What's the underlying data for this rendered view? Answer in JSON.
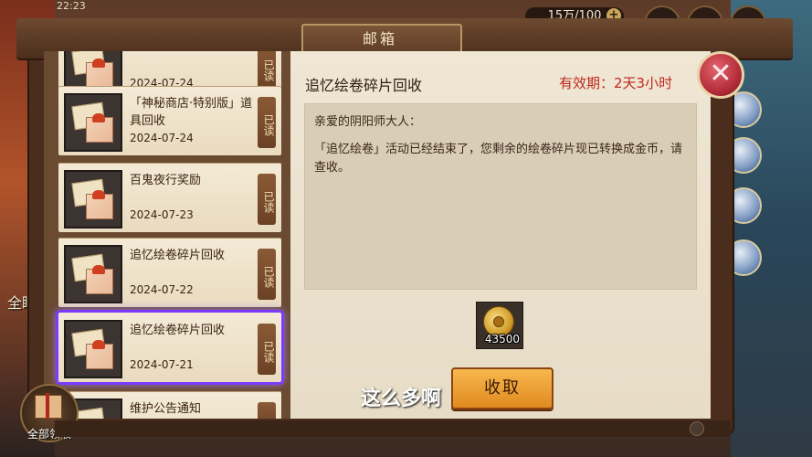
{
  "hud": {
    "time": "22:23",
    "currency": "15万/100",
    "plus": "+"
  },
  "window": {
    "title": "邮箱",
    "close_glyph": "✕"
  },
  "mail_list": [
    {
      "title": "",
      "date": "2024-07-24",
      "read": "已读"
    },
    {
      "title": "「神秘商店·特别版」道具回收",
      "date": "2024-07-24",
      "read": "已读"
    },
    {
      "title": "百鬼夜行奖励",
      "date": "2024-07-23",
      "read": "已读"
    },
    {
      "title": "追忆绘卷碎片回收",
      "date": "2024-07-22",
      "read": "已读"
    },
    {
      "title": "追忆绘卷碎片回收",
      "date": "2024-07-21",
      "read": "已读"
    },
    {
      "title": "维护公告通知",
      "date": "",
      "read": ""
    }
  ],
  "detail": {
    "title": "追忆绘卷碎片回收",
    "expiry": "有效期：2天3小时",
    "greeting": "亲爱的阴阳师大人：",
    "body": "「追忆绘卷」活动已经结束了，您剩余的绘卷碎片现已转换成金币，请查收。",
    "reward_count": "43500",
    "reward_icon": "gold-coin-icon",
    "claim_label": "收取"
  },
  "claim_all_label": "全部领取",
  "brightness_label": "全睛",
  "caption": "这么多啊",
  "colors": {
    "expiry": "#c0281e",
    "selection": "#7b3cff",
    "claim_button": "#f0a33a"
  }
}
